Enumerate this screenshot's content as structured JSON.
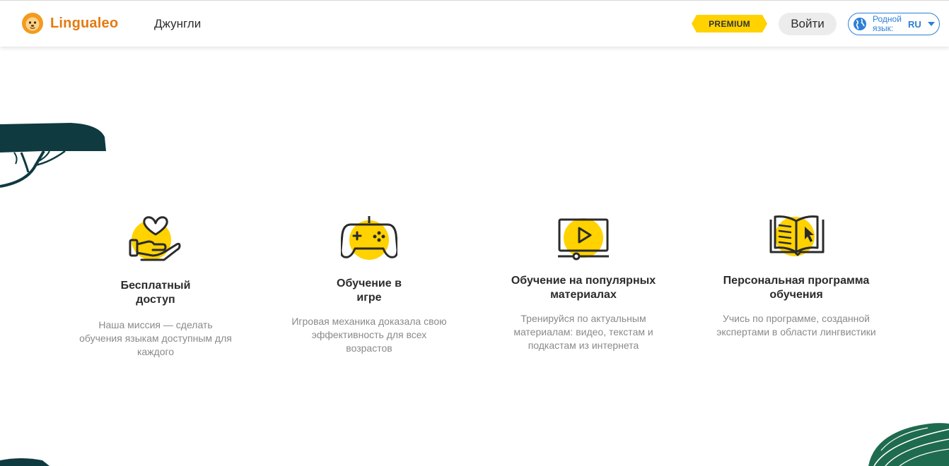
{
  "header": {
    "logo_text": "Lingualeo",
    "nav_jungle": "Джунгли",
    "premium_label": "PREMIUM",
    "login_label": "Войти",
    "native_language_label": "Родной язык:",
    "native_language_value": "RU"
  },
  "features": [
    {
      "icon": "heart-in-hand-icon",
      "title": "Бесплатный доступ",
      "description": "Наша миссия — сделать обучения языкам доступным для каждого"
    },
    {
      "icon": "gamepad-icon",
      "title": "Обучение в игре",
      "description": "Игровая механика доказала свою эффективность для всех возрастов"
    },
    {
      "icon": "video-monitor-icon",
      "title": "Обучение на популярных материалах",
      "description": "Тренируйся по актуальным материалам: видео, текстам и подкастам из интернета"
    },
    {
      "icon": "open-book-cursor-icon",
      "title": "Персональная программа обучения",
      "description": "Учись по программе, созданной экспертами в области лингвистики"
    }
  ],
  "colors": {
    "brand_orange": "#e47a10",
    "accent_yellow": "#ffd200",
    "link_blue": "#2e7fd6",
    "jungle_dark_teal": "#0e3a40",
    "jungle_green": "#1f6b4f",
    "icon_stroke": "#2b2b2b",
    "muted_text": "#8a8a8a"
  }
}
